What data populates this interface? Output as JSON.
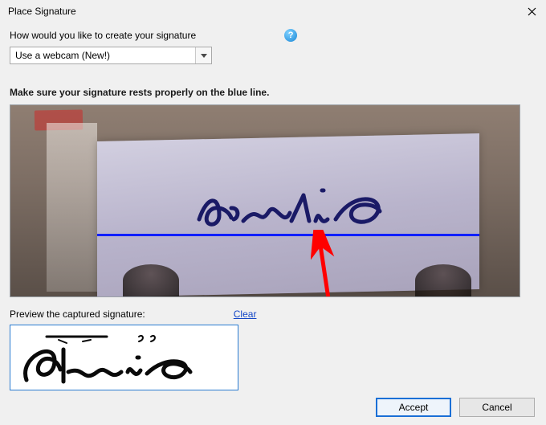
{
  "window": {
    "title": "Place Signature"
  },
  "prompt": {
    "label": "How would you like to create your signature"
  },
  "method_select": {
    "selected": "Use a webcam (New!)"
  },
  "instruction": "Make sure your signature rests properly on the blue line.",
  "preview": {
    "label": "Preview the captured signature:",
    "clear": "Clear"
  },
  "buttons": {
    "accept": "Accept",
    "cancel": "Cancel"
  }
}
